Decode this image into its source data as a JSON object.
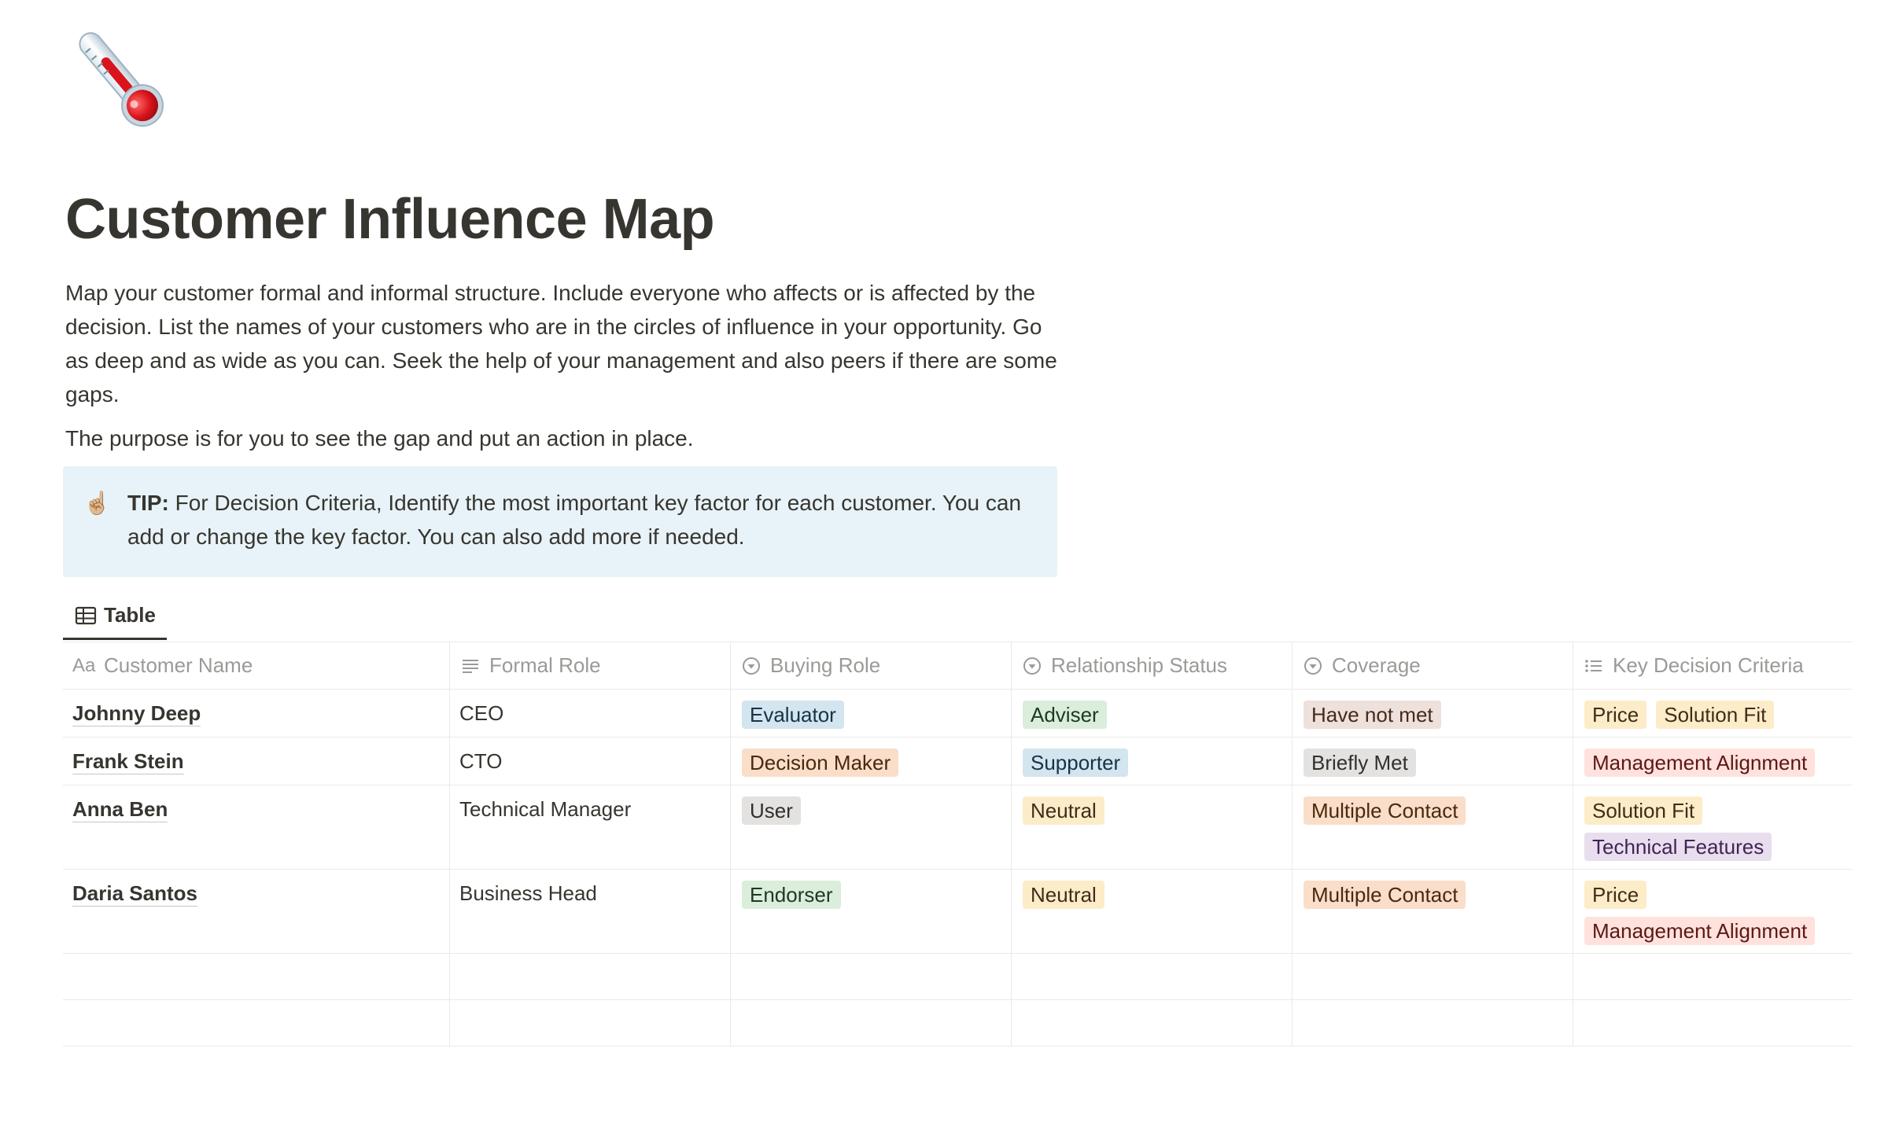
{
  "page": {
    "icon": "thermometer-icon",
    "title": "Customer Influence Map",
    "description": "Map your customer formal and informal structure. Include everyone who affects or is affected by the decision. List the names of your customers who are in the circles of influence in your opportunity. Go as deep and as wide as you can. Seek the help of your management and also peers if there are some gaps.",
    "purpose": "The purpose is for you to see the gap and put an action in place."
  },
  "callout": {
    "icon": "pointing-up-icon",
    "emoji": "☝🏼",
    "label": "TIP:",
    "text": " For Decision Criteria, Identify the most important key factor for each customer. You can add or change the key factor. You can also add more if needed."
  },
  "view": {
    "tab_label": "Table",
    "tab_icon": "table-icon"
  },
  "table": {
    "columns": [
      {
        "label": "Customer Name",
        "icon": "text-aa-icon"
      },
      {
        "label": "Formal Role",
        "icon": "lines-icon"
      },
      {
        "label": "Buying Role",
        "icon": "select-icon"
      },
      {
        "label": "Relationship Status",
        "icon": "select-icon"
      },
      {
        "label": "Coverage",
        "icon": "select-icon"
      },
      {
        "label": "Key Decision Criteria",
        "icon": "list-icon"
      }
    ],
    "rows": [
      {
        "name": "Johnny Deep",
        "formal_role": "CEO",
        "buying_role": "Evaluator",
        "relationship_status": "Adviser",
        "coverage": "Have not met",
        "criteria": [
          "Price",
          "Solution Fit"
        ]
      },
      {
        "name": "Frank Stein",
        "formal_role": "CTO",
        "buying_role": "Decision Maker",
        "relationship_status": "Supporter",
        "coverage": "Briefly Met",
        "criteria": [
          "Management Alignment"
        ]
      },
      {
        "name": "Anna Ben",
        "formal_role": "Technical Manager",
        "buying_role": "User",
        "relationship_status": "Neutral",
        "coverage": "Multiple Contact",
        "criteria": [
          "Solution Fit",
          "Technical Features"
        ]
      },
      {
        "name": "Daria Santos",
        "formal_role": "Business Head",
        "buying_role": "Endorser",
        "relationship_status": "Neutral",
        "coverage": "Multiple Contact",
        "criteria": [
          "Price",
          "Management Alignment"
        ]
      }
    ]
  },
  "tag_colors": {
    "blue_bg": "#d3e5ef",
    "green_bg": "#dbeddb",
    "orange_bg": "#fadec9",
    "gray_bg": "#e3e2e0",
    "yellow_bg": "#fdecc8",
    "brown_bg": "#eee0da",
    "red_bg": "#ffe2dd",
    "purple_bg": "#e8deee"
  }
}
